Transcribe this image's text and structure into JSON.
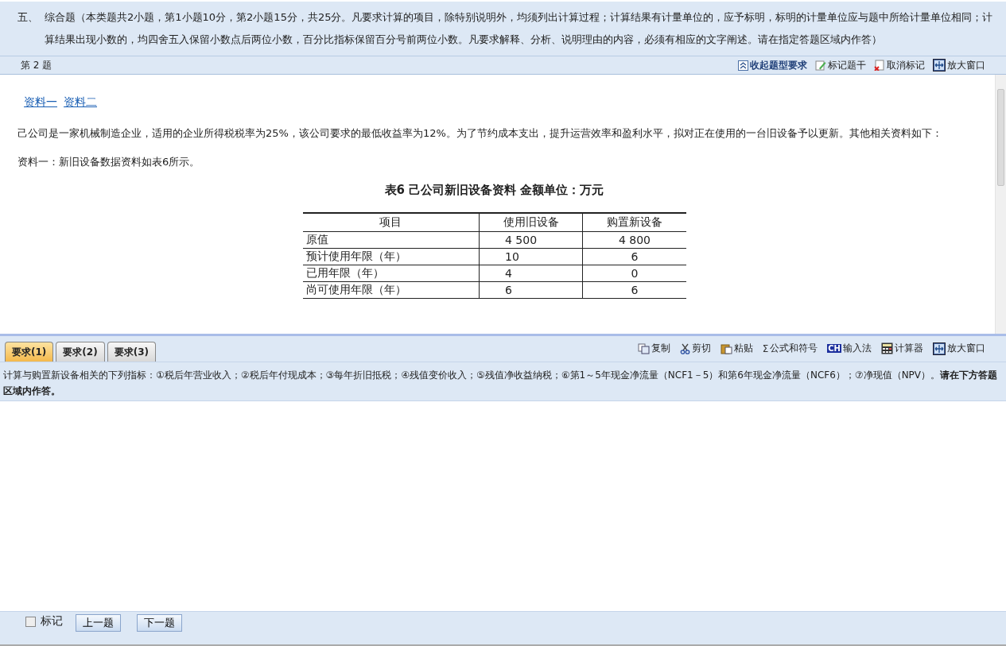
{
  "instructions": {
    "number": "五、",
    "text": "综合题（本类题共2小题，第1小题10分，第2小题15分，共25分。凡要求计算的项目，除特别说明外，均须列出计算过程；计算结果有计量单位的，应予标明，标明的计量单位应与题中所给计量单位相同；计算结果出现小数的，均四舍五入保留小数点后两位小数，百分比指标保留百分号前两位小数。凡要求解释、分析、说明理由的内容，必须有相应的文字阐述。请在指定答题区域内作答）"
  },
  "question_bar": {
    "label": "第 2 题",
    "tools": [
      {
        "kind": "collapse",
        "label": "收起题型要求"
      },
      {
        "kind": "mark",
        "label": "标记题干"
      },
      {
        "kind": "unmark",
        "label": "取消标记"
      },
      {
        "kind": "maximize",
        "label": "放大窗口"
      }
    ]
  },
  "material_links": [
    "资料一",
    "资料二"
  ],
  "paragraphs": [
    "己公司是一家机械制造企业，适用的企业所得税税率为25%，该公司要求的最低收益率为12%。为了节约成本支出，提升运营效率和盈利水平，拟对正在使用的一台旧设备予以更新。其他相关资料如下：",
    "资料一：新旧设备数据资料如表6所示。"
  ],
  "table": {
    "title": "表6  己公司新旧设备资料  金额单位：万元",
    "columns": [
      "项目",
      "使用旧设备",
      "购置新设备"
    ],
    "rows": [
      [
        "原值",
        "4 500",
        "4 800"
      ],
      [
        "预计使用年限（年）",
        "10",
        "6"
      ],
      [
        "已用年限（年）",
        "4",
        "0"
      ],
      [
        "尚可使用年限（年）",
        "6",
        "6"
      ]
    ]
  },
  "requirement_tabs": [
    {
      "label": "要求(1)",
      "selected": true
    },
    {
      "label": "要求(2)",
      "selected": false
    },
    {
      "label": "要求(3)",
      "selected": false
    }
  ],
  "editor_tools": [
    {
      "kind": "copy",
      "label": "复制"
    },
    {
      "kind": "cut",
      "label": "剪切"
    },
    {
      "kind": "paste",
      "label": "粘贴"
    },
    {
      "kind": "formula",
      "label": "公式和符号",
      "icon_text": "Σ"
    },
    {
      "kind": "ime",
      "label": "输入法",
      "icon_text": "CH"
    },
    {
      "kind": "calculator",
      "label": "计算器"
    },
    {
      "kind": "maximize",
      "label": "放大窗口"
    }
  ],
  "requirement_text": "计算与购置新设备相关的下列指标：①税后年营业收入；②税后年付现成本；③每年折旧抵税；④残值变价收入；⑤残值净收益纳税；⑥第1～5年现金净流量（NCF1－5）和第6年现金净流量（NCF6）；⑦净现值（NPV）。**请在下方答题区域内作答。**",
  "footer": {
    "mark": {
      "label": "标记",
      "checked": false
    },
    "buttons": [
      "上一题",
      "下一题"
    ]
  }
}
